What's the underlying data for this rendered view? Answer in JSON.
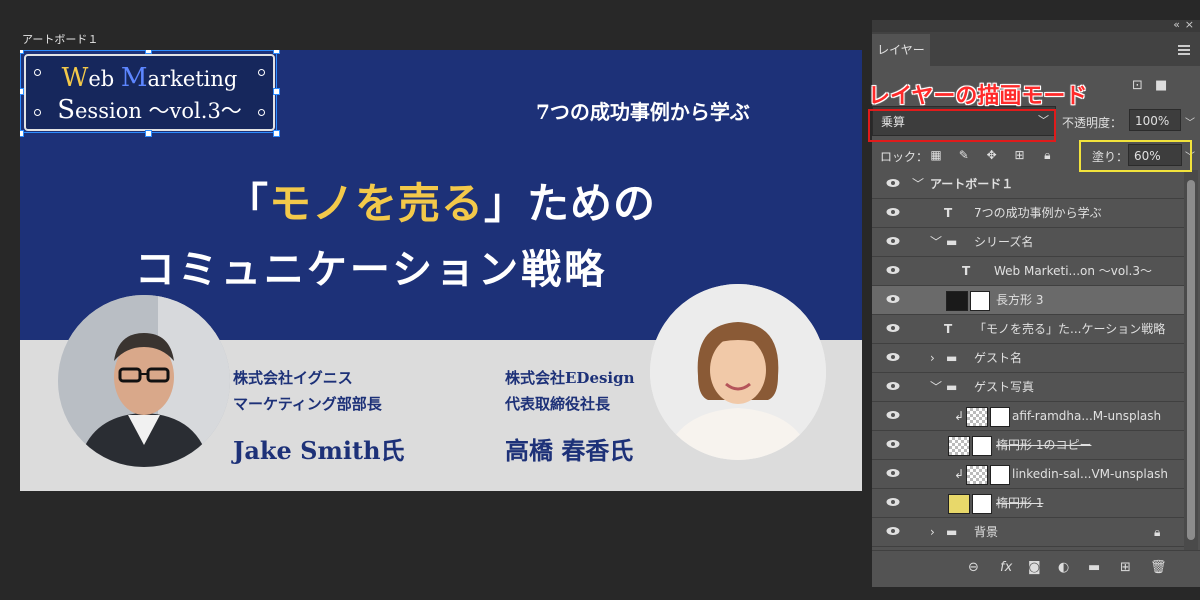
{
  "canvas": {
    "artboard_label": "アートボード１",
    "series_title": {
      "w_accent": "W",
      "line1_rest": "eb ",
      "m_accent": "M",
      "line1_end": "arketing",
      "s_accent": "S",
      "line2_rest": "ession ～vol.3～"
    },
    "tagline": "7つの成功事例から学ぶ",
    "headline": {
      "open_bracket": "「",
      "highlight": "モノを売る",
      "close_rest": "」ための",
      "line2": "コミュニケーション戦略"
    },
    "guest1": {
      "company": "株式会社イグニス",
      "role": "マーケティング部部長",
      "name": "Jake Smith氏"
    },
    "guest2": {
      "company": "株式会社EDesign",
      "role": "代表取締役社長",
      "name": "高橋 春香氏"
    },
    "colors": {
      "navy": "#1d3178",
      "highlight": "#f3c94a",
      "light_bg": "#dcdcdc"
    }
  },
  "annotation": "レイヤーの描画モード",
  "panel": {
    "tab": "レイヤー",
    "blend_mode": "乗算",
    "opacity_label": "不透明度：",
    "opacity_value": "100%",
    "lock_label": "ロック：",
    "fill_label": "塗り：",
    "fill_value": "60%",
    "layers": [
      {
        "label": "アートボード１",
        "kind": "artboard"
      },
      {
        "label": "7つの成功事例から学ぶ",
        "kind": "text"
      },
      {
        "label": "シリーズ名",
        "kind": "group-open"
      },
      {
        "label": "Web Marketi...on ～vol.3～",
        "kind": "text"
      },
      {
        "label": "長方形 3",
        "kind": "shape",
        "selected": true
      },
      {
        "label": "「モノを売る」た...ケーション戦略",
        "kind": "text"
      },
      {
        "label": "ゲスト名",
        "kind": "group-closed"
      },
      {
        "label": "ゲスト写真",
        "kind": "group-open"
      },
      {
        "label": "afif-ramdha...M-unsplash",
        "kind": "clipped-image"
      },
      {
        "label": "楕円形 1のコピー",
        "kind": "shape"
      },
      {
        "label": "linkedin-sal...VM-unsplash",
        "kind": "clipped-image"
      },
      {
        "label": "楕円形 1",
        "kind": "shape"
      },
      {
        "label": "背景",
        "kind": "group-closed"
      }
    ]
  }
}
